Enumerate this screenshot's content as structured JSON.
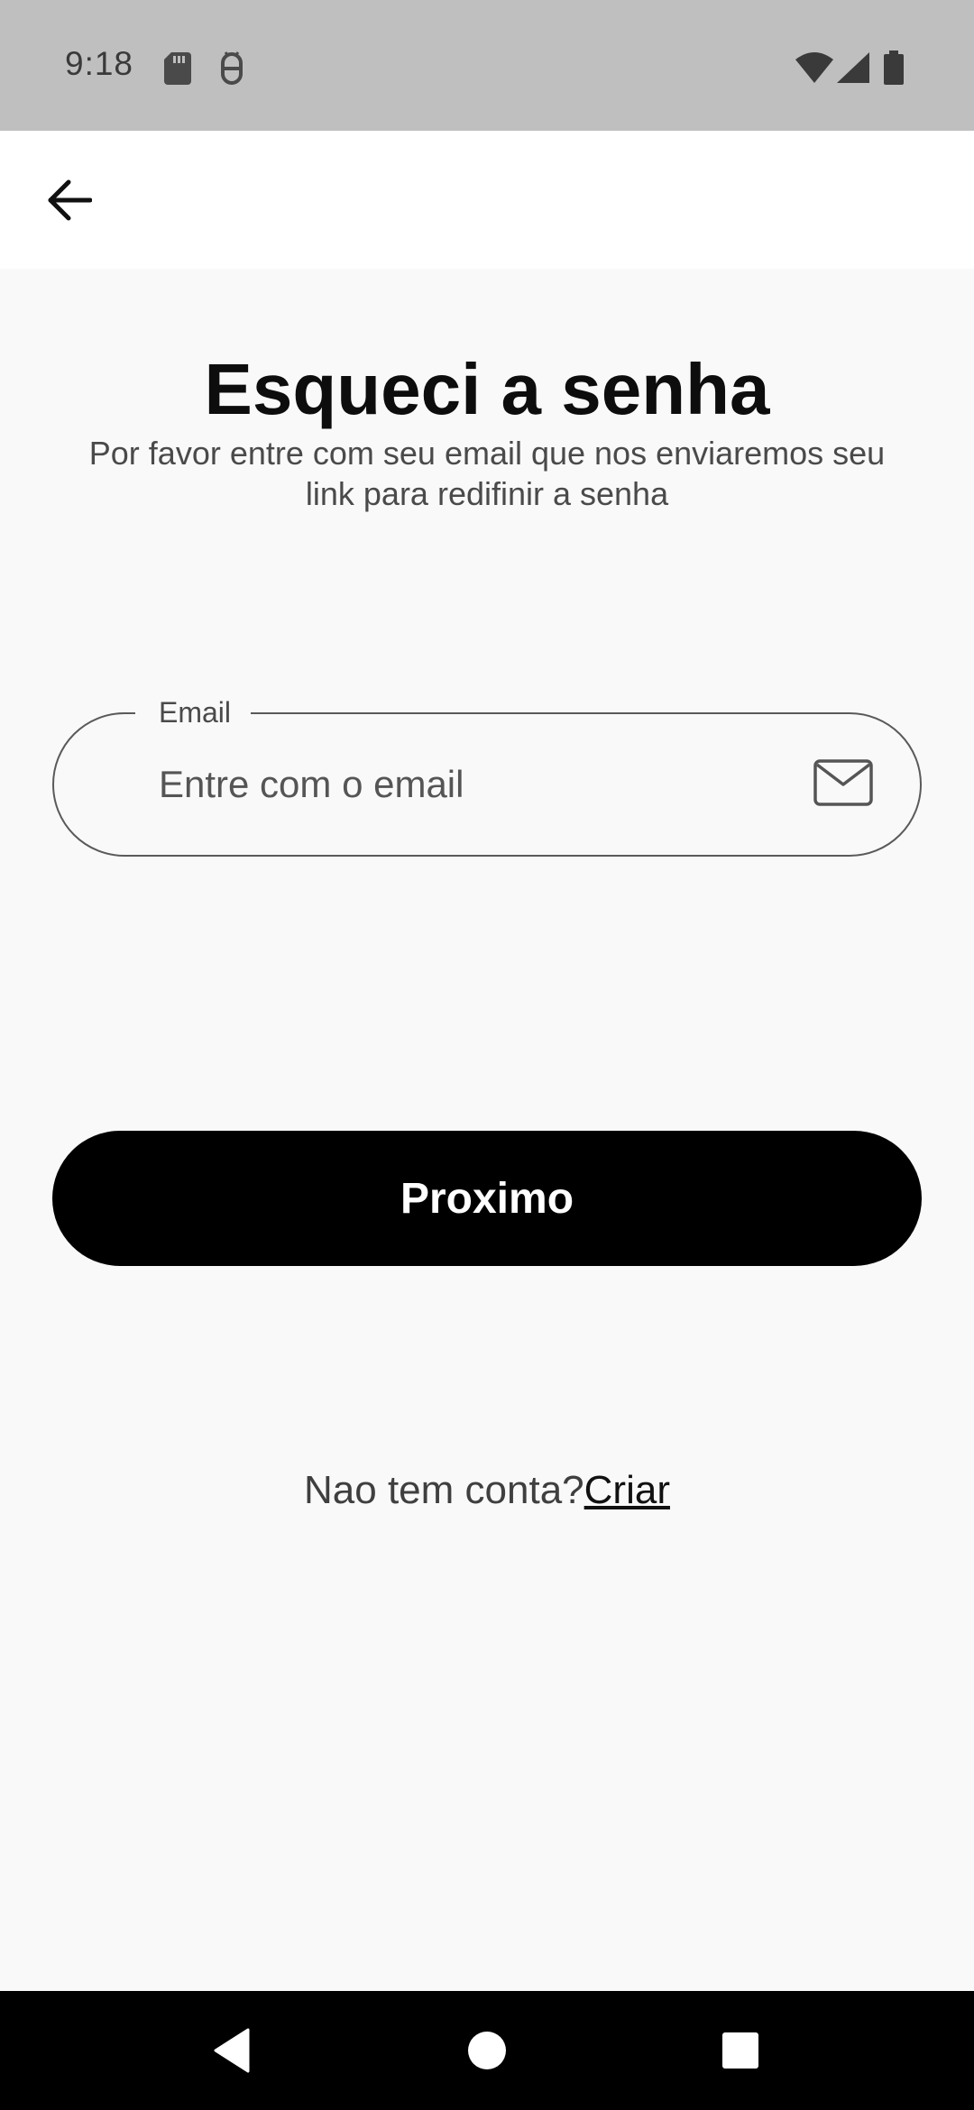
{
  "status_bar": {
    "time": "9:18",
    "left_icons": [
      "sd-card-icon",
      "android-debug-icon"
    ],
    "right_icons": [
      "wifi-icon",
      "cellular-signal-icon",
      "battery-icon"
    ]
  },
  "app_bar": {
    "back_icon": "arrow-back-icon"
  },
  "header": {
    "title": "Esqueci a senha",
    "subtitle": "Por favor entre com seu email que nos enviaremos seu link para redifinir a senha"
  },
  "form": {
    "email_label": "Email",
    "email_placeholder": "Entre com o email",
    "email_value": "",
    "email_icon": "mail-icon",
    "next_button_label": "Proximo"
  },
  "footer": {
    "prompt": "Nao tem conta?",
    "link_label": "Criar"
  },
  "nav_bar": {
    "buttons": [
      "back-triangle-icon",
      "home-circle-icon",
      "recents-square-icon"
    ]
  },
  "colors": {
    "status_bar_bg": "#bfbfbf",
    "app_bar_bg": "#ffffff",
    "page_bg": "#f9f9f9",
    "primary_button_bg": "#000000",
    "primary_button_text": "#ffffff",
    "nav_bar_bg": "#000000"
  }
}
